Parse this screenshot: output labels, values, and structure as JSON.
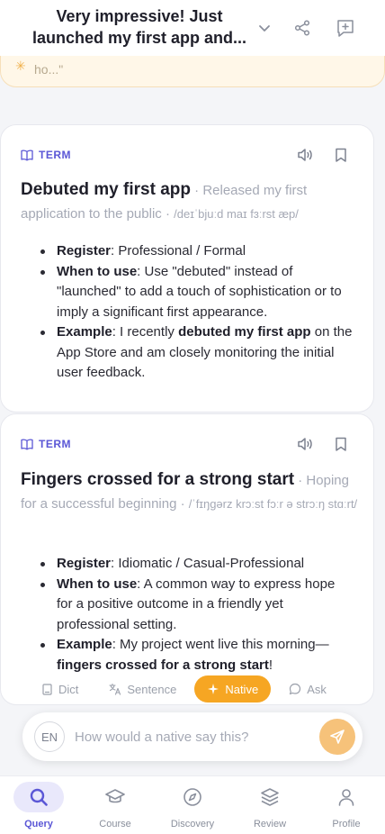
{
  "header": {
    "title": "Very impressive! Just launched my first app and..."
  },
  "banner": {
    "text": "ho...\""
  },
  "cards": [
    {
      "tag": "TERM",
      "term": "Debuted my first app",
      "separator": " · ",
      "meaning": "Released my first application to the public",
      "separator2": " · ",
      "phonetic": "/deɪˈbjuːd maɪ fɜːrst æp/",
      "bullets": [
        {
          "label": "Register",
          "text": ": Professional / Formal"
        },
        {
          "label": "When to use",
          "text": ": Use \"debuted\" instead of \"launched\" to add a touch of sophistication or to imply a significant first appearance."
        },
        {
          "label": "Example",
          "text_before": ": I recently ",
          "bold": "debuted my first app",
          "text_after": " on the App Store and am closely monitoring the initial user feedback."
        }
      ]
    },
    {
      "tag": "TERM",
      "term": "Fingers crossed for a strong start",
      "separator": " · ",
      "meaning": "Hoping for a successful beginning",
      "separator2": " · ",
      "phonetic": "/ˈfɪŋɡərz krɔːst fɔːr ə strɔːŋ stɑːrt/",
      "bullets": [
        {
          "label": "Register",
          "text": ": Idiomatic / Casual-Professional"
        },
        {
          "label": "When to use",
          "text": ": A common way to express hope for a positive outcome in a friendly yet professional setting."
        },
        {
          "label": "Example",
          "text_before": ": My project went live this morning—",
          "bold": "fingers crossed for a strong start",
          "text_after": "!"
        }
      ]
    }
  ],
  "tools": {
    "dict": "Dict",
    "sentence": "Sentence",
    "native": "Native",
    "ask": "Ask"
  },
  "input": {
    "lang": "EN",
    "placeholder": "How would a native say this?"
  },
  "nav": {
    "items": [
      {
        "label": "Query"
      },
      {
        "label": "Course"
      },
      {
        "label": "Discovery"
      },
      {
        "label": "Review"
      },
      {
        "label": "Profile"
      }
    ]
  },
  "colors": {
    "accent": "#5b57d6",
    "native_chip": "#f6a623",
    "send_button": "#f6c27a",
    "banner_bg": "#fff7e8"
  }
}
